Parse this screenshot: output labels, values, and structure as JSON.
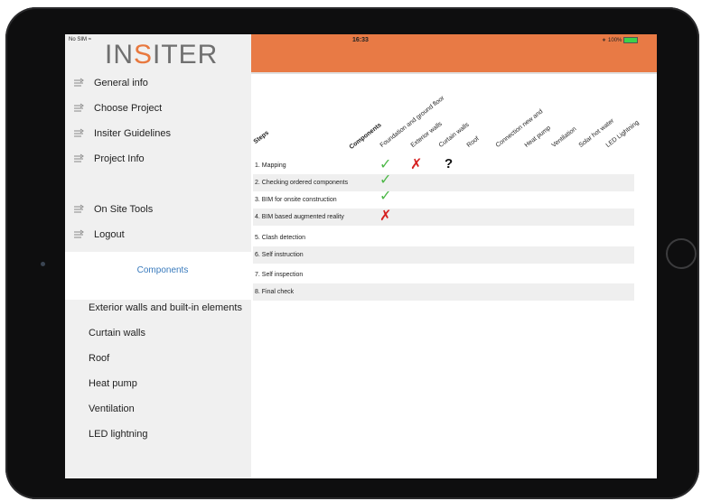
{
  "status_bar": {
    "carrier": "No SIM",
    "time": "16:33",
    "battery": "100%"
  },
  "logo": {
    "part1": "IN",
    "part2": "S",
    "part3": "ITER"
  },
  "menu": [
    {
      "label": "General info"
    },
    {
      "label": "Choose Project"
    },
    {
      "label": "Insiter Guidelines"
    },
    {
      "label": "Project Info"
    },
    {
      "label": "On Site Tools"
    },
    {
      "label": "Logout"
    }
  ],
  "components_section": {
    "title": "Components",
    "items": [
      "Exterior walls and built-in elements",
      "Curtain walls",
      "Roof",
      "Heat pump",
      "Ventilation",
      "LED lightning"
    ]
  },
  "table": {
    "steps_header": "Steps",
    "components_header": "Components",
    "columns": [
      "Foundation and ground floor",
      "Exterior walls",
      "Curtain walls",
      "Roof",
      "Connection new and",
      "Heat pump",
      "Ventilation",
      "Solar hot water",
      "LED Lightning"
    ],
    "rows": [
      "1. Mapping",
      "2. Checking ordered components",
      "3. BIM for onsite construction",
      "4. BIM based augmented reality",
      "5. Clash detection",
      "6. Self instruction",
      "7. Self inspection",
      "8. Final check"
    ],
    "marks": [
      {
        "row": 0,
        "col": 0,
        "type": "check",
        "glyph": "✓"
      },
      {
        "row": 0,
        "col": 1,
        "type": "cross",
        "glyph": "✗"
      },
      {
        "row": 0,
        "col": 2,
        "type": "question",
        "glyph": "?"
      },
      {
        "row": 1,
        "col": 0,
        "type": "check",
        "glyph": "✓"
      },
      {
        "row": 2,
        "col": 0,
        "type": "check",
        "glyph": "✓"
      },
      {
        "row": 3,
        "col": 0,
        "type": "cross",
        "glyph": "✗"
      }
    ]
  },
  "colors": {
    "accent": "#e87a45",
    "check": "#4db848",
    "cross": "#d62121",
    "link": "#3a7bbd"
  }
}
